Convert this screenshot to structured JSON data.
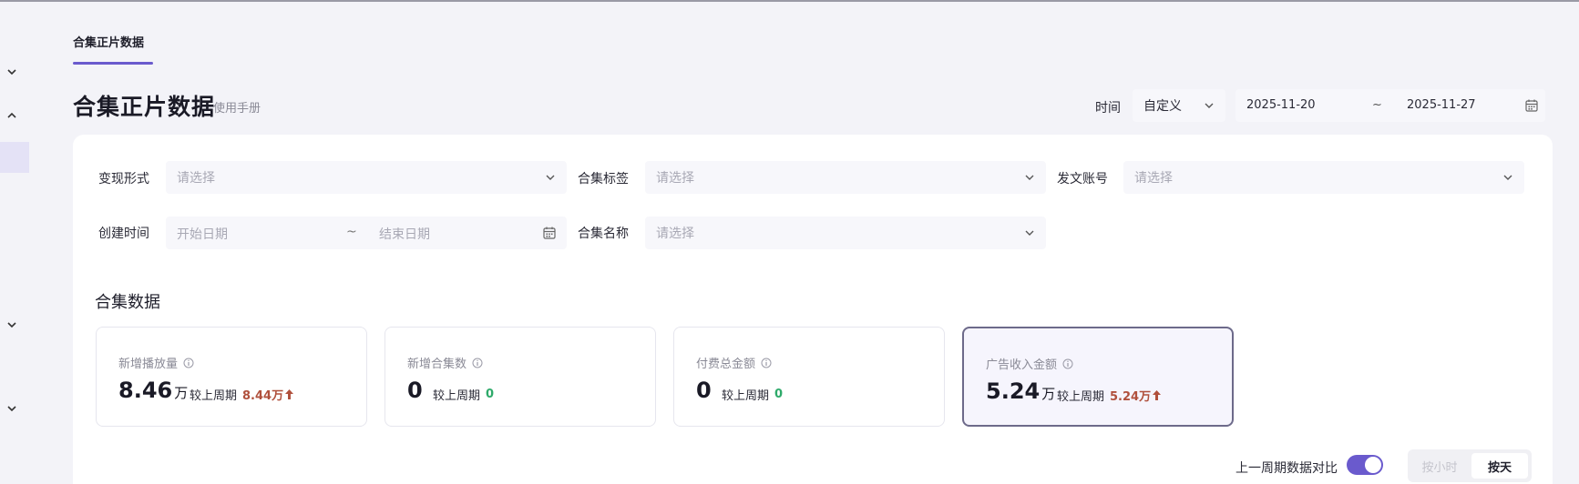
{
  "tabs": [
    {
      "label": "合集正片数据",
      "active": true
    }
  ],
  "page": {
    "title": "合集正片数据",
    "manual_link": "使用手册"
  },
  "time_filter": {
    "label": "时间",
    "mode": "自定义",
    "start": "2025-11-20",
    "separator": "~",
    "end": "2025-11-27"
  },
  "filters": {
    "monetization": {
      "label": "变现形式",
      "placeholder": "请选择"
    },
    "collection_tag": {
      "label": "合集标签",
      "placeholder": "请选择"
    },
    "publish_account": {
      "label": "发文账号",
      "placeholder": "请选择"
    },
    "create_time": {
      "label": "创建时间",
      "start_placeholder": "开始日期",
      "separator": "~",
      "end_placeholder": "结束日期"
    },
    "collection_name": {
      "label": "合集名称",
      "placeholder": "请选择"
    }
  },
  "section_title": "合集数据",
  "cards": [
    {
      "label": "新增播放量",
      "value": "8.46",
      "unit": "万",
      "compare_label": "较上周期",
      "compare_value": "8.44万",
      "trend": "up"
    },
    {
      "label": "新增合集数",
      "value": "0",
      "unit": "",
      "compare_label": "较上周期",
      "compare_value": "0",
      "trend": "flat"
    },
    {
      "label": "付费总金额",
      "value": "0",
      "unit": "",
      "compare_label": "较上周期",
      "compare_value": "0",
      "trend": "flat"
    },
    {
      "label": "广告收入金额",
      "value": "5.24",
      "unit": "万",
      "compare_label": "较上周期",
      "compare_value": "5.24万",
      "trend": "up",
      "active": true
    }
  ],
  "compare_toggle": {
    "label": "上一周期数据对比",
    "enabled": true
  },
  "granularity": {
    "options": [
      "按小时",
      "按天"
    ],
    "selected": "按天"
  },
  "colors": {
    "accent": "#6a5acd",
    "up": "#b0503c",
    "zero": "#2eaa6a"
  }
}
